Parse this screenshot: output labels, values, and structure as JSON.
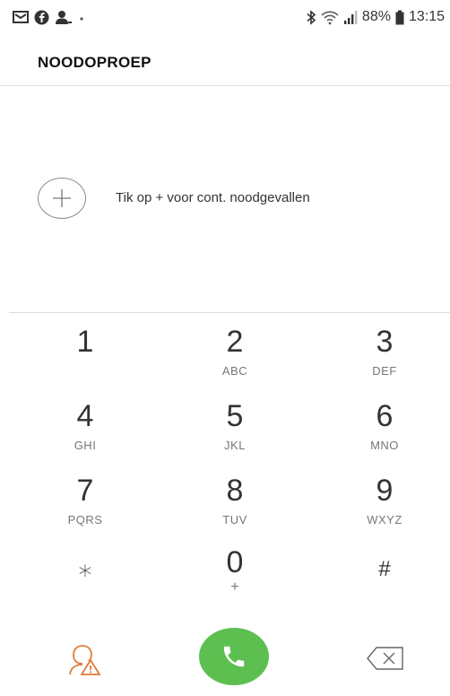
{
  "status_bar": {
    "battery_percent": "88%",
    "time": "13:15",
    "left_icons": [
      "mail-icon",
      "facebook-icon",
      "user-status-icon",
      "dot-icon"
    ],
    "right_icons": [
      "bluetooth-icon",
      "wifi-icon",
      "signal-icon",
      "battery-icon"
    ]
  },
  "header": {
    "title": "NOODOPROEP"
  },
  "emergency_contacts": {
    "add_icon": "plus-icon",
    "hint": "Tik op + voor cont. noodgevallen"
  },
  "dialpad": {
    "keys": [
      {
        "digit": "1",
        "letters": ""
      },
      {
        "digit": "2",
        "letters": "ABC"
      },
      {
        "digit": "3",
        "letters": "DEF"
      },
      {
        "digit": "4",
        "letters": "GHI"
      },
      {
        "digit": "5",
        "letters": "JKL"
      },
      {
        "digit": "6",
        "letters": "MNO"
      },
      {
        "digit": "7",
        "letters": "PQRS"
      },
      {
        "digit": "8",
        "letters": "TUV"
      },
      {
        "digit": "9",
        "letters": "WXYZ"
      },
      {
        "digit": "⁎",
        "letters": ""
      },
      {
        "digit": "0",
        "letters": "+"
      },
      {
        "digit": "#",
        "letters": ""
      }
    ]
  },
  "bottom_bar": {
    "left_icon": "emergency-contact-icon",
    "call_icon": "phone-icon",
    "right_icon": "backspace-icon",
    "call_color": "#5cbf4f",
    "accent_color": "#e07a3a"
  }
}
